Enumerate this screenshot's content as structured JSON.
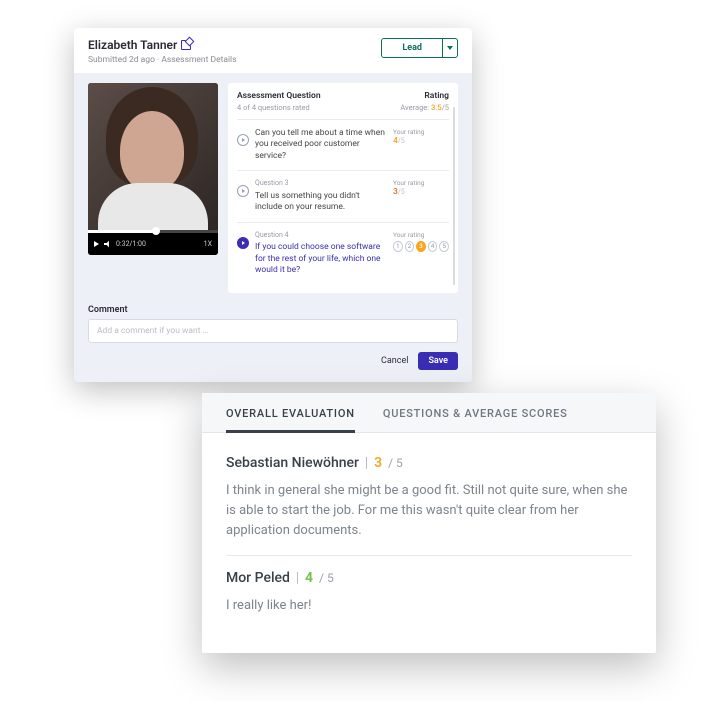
{
  "header": {
    "candidate_name": "Elizabeth Tanner",
    "submitted_line": "Submitted 2d ago · Assessment Details",
    "stage_label": "Lead"
  },
  "video": {
    "time": "0:32/1:00",
    "quality": "1X"
  },
  "assessment": {
    "title": "Assessment Question",
    "progress": "4 of 4 questions rated",
    "rating_label": "Rating",
    "average_label": "Average:",
    "average_value": "3.5",
    "average_of": "/5",
    "your_rating_label": "Your rating"
  },
  "questions": [
    {
      "label": "",
      "text": "Can you tell me about a time when you received poor customer service?",
      "rating": "4",
      "of": "/5",
      "active": false,
      "show_dots": false
    },
    {
      "label": "Question 3",
      "text": "Tell us something you didn't include on your resume.",
      "rating": "3",
      "of": "/5",
      "active": false,
      "show_dots": false
    },
    {
      "label": "Question 4",
      "text": "If you could choose one software for the rest of your life, which one would it be?",
      "rating": "",
      "of": "",
      "active": true,
      "show_dots": true,
      "selected_dot": 3
    }
  ],
  "comment": {
    "label": "Comment",
    "placeholder": "Add a comment if you want …"
  },
  "actions": {
    "cancel": "Cancel",
    "save": "Save"
  },
  "eval_tabs": {
    "overall": "OVERALL EVALUATION",
    "questions": "QUESTIONS & AVERAGE SCORES"
  },
  "evaluations": [
    {
      "name": "Sebastian Niewöhner",
      "score": "3",
      "of": "/ 5",
      "score_class": "s3",
      "text": "I think in general she might be a good fit. Still not quite sure, when she is able to start the job. For me this wasn't quite clear from her application documents."
    },
    {
      "name": "Mor Peled",
      "score": "4",
      "of": "/ 5",
      "score_class": "s4",
      "text": "I really like her!"
    }
  ]
}
